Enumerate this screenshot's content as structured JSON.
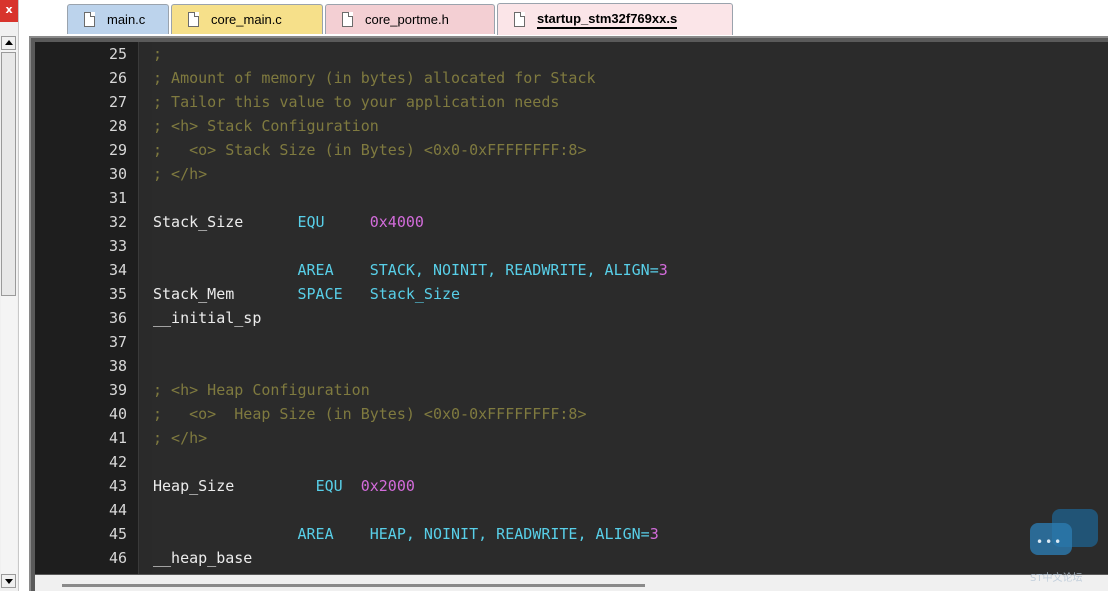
{
  "window": {
    "close_glyph": "x"
  },
  "tabs": [
    {
      "label": "main.c",
      "color": "#bcd3ec",
      "active": false
    },
    {
      "label": "core_main.c",
      "color": "#f6e08a",
      "active": false
    },
    {
      "label": "core_portme.h",
      "color": "#f3cfd3",
      "active": false
    },
    {
      "label": "startup_stm32f769xx.s",
      "color": "#fbe5e8",
      "active": true
    }
  ],
  "editor": {
    "line_numbers": [
      "25",
      "26",
      "27",
      "28",
      "29",
      "30",
      "31",
      "32",
      "33",
      "34",
      "35",
      "36",
      "37",
      "38",
      "39",
      "40",
      "41",
      "42",
      "43",
      "44",
      "45",
      "46"
    ],
    "lines": [
      {
        "comment": ";"
      },
      {
        "comment": "; Amount of memory (in bytes) allocated for Stack"
      },
      {
        "comment": "; Tailor this value to your application needs"
      },
      {
        "comment": "; <h> Stack Configuration"
      },
      {
        "comment": ";   <o> Stack Size (in Bytes) <0x0-0xFFFFFFFF:8>"
      },
      {
        "comment": "; </h>"
      },
      {},
      {
        "label": "Stack_Size",
        "keyword": "EQU",
        "value": "0x4000"
      },
      {},
      {
        "keyword": "AREA",
        "operands": "STACK, NOINIT, READWRITE, ALIGN=",
        "number": "3"
      },
      {
        "label": "Stack_Mem",
        "keyword": "SPACE",
        "operands": "Stack_Size"
      },
      {
        "label": "__initial_sp"
      },
      {},
      {},
      {
        "comment": "; <h> Heap Configuration"
      },
      {
        "comment": ";   <o>  Heap Size (in Bytes) <0x0-0xFFFFFFFF:8>"
      },
      {
        "comment": "; </h>"
      },
      {},
      {
        "label": "Heap_Size",
        "keyword": "EQU",
        "value": "0x2000"
      },
      {},
      {
        "keyword": "AREA",
        "operands": "HEAP, NOINIT, READWRITE, ALIGN=",
        "number": "3"
      },
      {
        "label": "__heap_base"
      }
    ]
  },
  "colors": {
    "comment": "#7f7a3f",
    "keyword": "#58cfe8",
    "number": "#d36cdb",
    "text": "#ececec",
    "background": "#2b2b2b"
  },
  "icons": {
    "file": "file-icon",
    "close": "close-icon",
    "scroll_up": "scroll-up-icon",
    "scroll_down": "scroll-down-icon",
    "watermark": "chat-bubble-icon"
  },
  "watermark": {
    "text": "ST中文论坛"
  }
}
